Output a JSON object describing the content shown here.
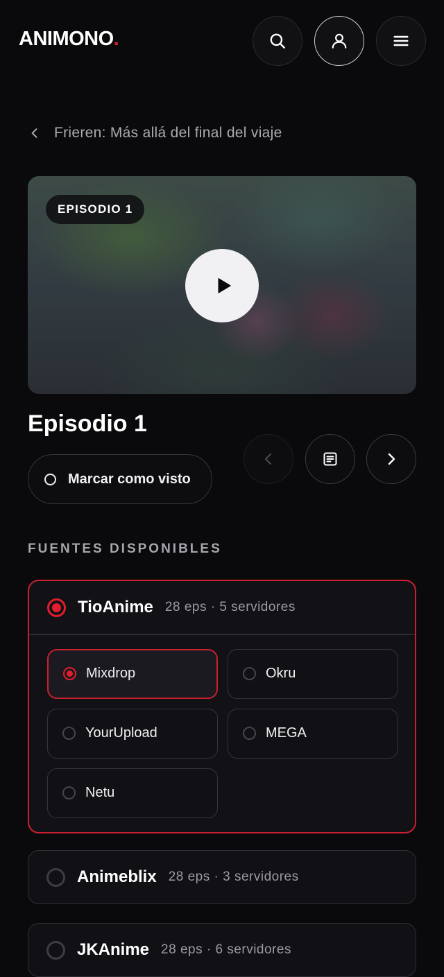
{
  "header": {
    "logo_text": "ANIMONO",
    "logo_dot": ".",
    "accent_color": "#e11d2e",
    "buttons": [
      {
        "icon": "search-icon"
      },
      {
        "icon": "user-icon"
      },
      {
        "icon": "menu-icon"
      }
    ]
  },
  "breadcrumb": {
    "back_icon": "chevron-left-icon",
    "title": "Frieren: Más allá del final del viaje"
  },
  "player": {
    "badge": "EPISODIO 1",
    "play_icon": "play-icon"
  },
  "episode": {
    "title": "Episodio 1",
    "mark_label": "Marcar como visto",
    "nav": {
      "prev_icon": "chevron-left-icon",
      "list_icon": "episode-list-icon",
      "next_icon": "chevron-right-icon"
    }
  },
  "sources": {
    "label": "FUENTES DISPONIBLES",
    "items": [
      {
        "name": "TioAnime",
        "meta": "28 eps · 5 servidores",
        "selected": true,
        "servers": [
          {
            "label": "Mixdrop",
            "selected": true
          },
          {
            "label": "Okru",
            "selected": false
          },
          {
            "label": "YourUpload",
            "selected": false
          },
          {
            "label": "MEGA",
            "selected": false
          },
          {
            "label": "Netu",
            "selected": false
          }
        ]
      },
      {
        "name": "Animeblix",
        "meta": "28 eps · 3 servidores",
        "selected": false
      },
      {
        "name": "JKAnime",
        "meta": "28 eps · 6 servidores",
        "selected": false
      }
    ]
  }
}
